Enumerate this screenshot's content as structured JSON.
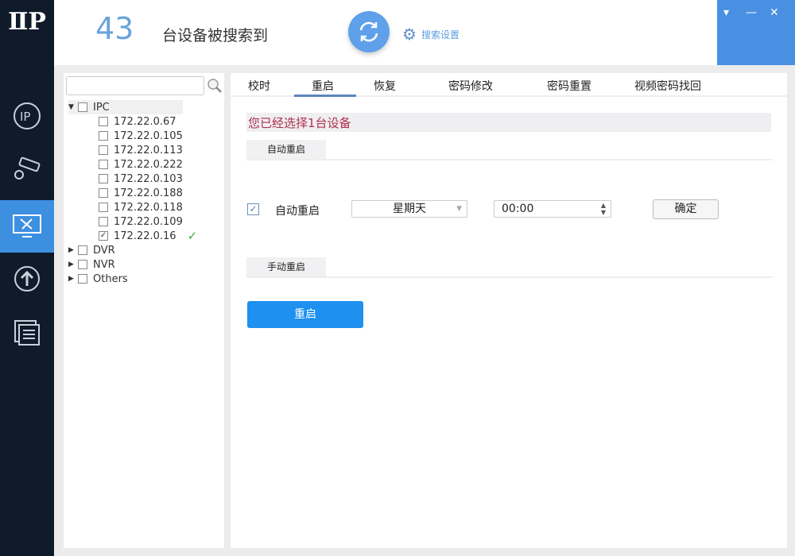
{
  "sidebar": {
    "logo": "IP",
    "items": [
      {
        "name": "ip-config"
      },
      {
        "name": "camera-settings"
      },
      {
        "name": "maintenance",
        "active": true
      },
      {
        "name": "upgrade"
      },
      {
        "name": "device-list"
      }
    ]
  },
  "header": {
    "device_count": "43",
    "count_label": "台设备被搜索到",
    "search_settings": "搜索设置"
  },
  "window": {
    "menu": "▾",
    "minimize": "—",
    "close": "✕"
  },
  "tree": {
    "search_placeholder": "",
    "groups": [
      {
        "label": "IPC",
        "expanded": true,
        "children": [
          {
            "ip": "172.22.0.67",
            "checked": false
          },
          {
            "ip": "172.22.0.105",
            "checked": false
          },
          {
            "ip": "172.22.0.113",
            "checked": false
          },
          {
            "ip": "172.22.0.222",
            "checked": false
          },
          {
            "ip": "172.22.0.103",
            "checked": false
          },
          {
            "ip": "172.22.0.188",
            "checked": false
          },
          {
            "ip": "172.22.0.118",
            "checked": false
          },
          {
            "ip": "172.22.0.109",
            "checked": false
          },
          {
            "ip": "172.22.0.16",
            "checked": true,
            "status": "✓"
          }
        ]
      },
      {
        "label": "DVR"
      },
      {
        "label": "NVR"
      },
      {
        "label": "Others"
      }
    ]
  },
  "tabs": [
    "校时",
    "重启",
    "恢复",
    "密码修改",
    "密码重置",
    "视频密码找回"
  ],
  "active_tab": "重启",
  "main": {
    "selection_info": "您已经选择1台设备",
    "auto_section": "自动重启",
    "auto_label": "自动重启",
    "auto_checked": true,
    "day": "星期天",
    "time": "00:00",
    "confirm": "确定",
    "manual_section": "手动重启",
    "reboot_button": "重启"
  },
  "colors": {
    "accent": "#1e90f0",
    "sidebar": "#0f1b2b",
    "warning_text": "#b03050"
  }
}
